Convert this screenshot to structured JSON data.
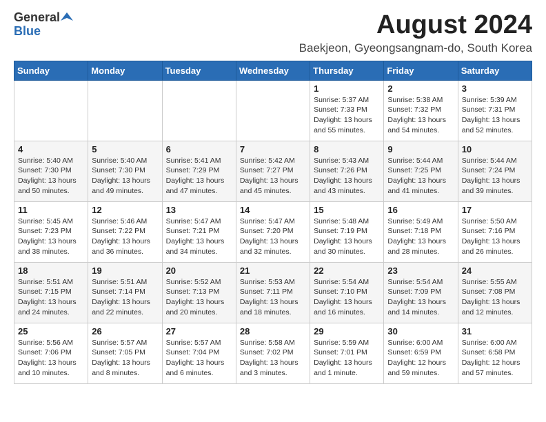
{
  "header": {
    "logo_general": "General",
    "logo_blue": "Blue",
    "title": "August 2024",
    "subtitle": "Baekjeon, Gyeongsangnam-do, South Korea"
  },
  "days_of_week": [
    "Sunday",
    "Monday",
    "Tuesday",
    "Wednesday",
    "Thursday",
    "Friday",
    "Saturday"
  ],
  "weeks": [
    [
      {
        "day": "",
        "info": ""
      },
      {
        "day": "",
        "info": ""
      },
      {
        "day": "",
        "info": ""
      },
      {
        "day": "",
        "info": ""
      },
      {
        "day": "1",
        "info": "Sunrise: 5:37 AM\nSunset: 7:33 PM\nDaylight: 13 hours\nand 55 minutes."
      },
      {
        "day": "2",
        "info": "Sunrise: 5:38 AM\nSunset: 7:32 PM\nDaylight: 13 hours\nand 54 minutes."
      },
      {
        "day": "3",
        "info": "Sunrise: 5:39 AM\nSunset: 7:31 PM\nDaylight: 13 hours\nand 52 minutes."
      }
    ],
    [
      {
        "day": "4",
        "info": "Sunrise: 5:40 AM\nSunset: 7:30 PM\nDaylight: 13 hours\nand 50 minutes."
      },
      {
        "day": "5",
        "info": "Sunrise: 5:40 AM\nSunset: 7:30 PM\nDaylight: 13 hours\nand 49 minutes."
      },
      {
        "day": "6",
        "info": "Sunrise: 5:41 AM\nSunset: 7:29 PM\nDaylight: 13 hours\nand 47 minutes."
      },
      {
        "day": "7",
        "info": "Sunrise: 5:42 AM\nSunset: 7:27 PM\nDaylight: 13 hours\nand 45 minutes."
      },
      {
        "day": "8",
        "info": "Sunrise: 5:43 AM\nSunset: 7:26 PM\nDaylight: 13 hours\nand 43 minutes."
      },
      {
        "day": "9",
        "info": "Sunrise: 5:44 AM\nSunset: 7:25 PM\nDaylight: 13 hours\nand 41 minutes."
      },
      {
        "day": "10",
        "info": "Sunrise: 5:44 AM\nSunset: 7:24 PM\nDaylight: 13 hours\nand 39 minutes."
      }
    ],
    [
      {
        "day": "11",
        "info": "Sunrise: 5:45 AM\nSunset: 7:23 PM\nDaylight: 13 hours\nand 38 minutes."
      },
      {
        "day": "12",
        "info": "Sunrise: 5:46 AM\nSunset: 7:22 PM\nDaylight: 13 hours\nand 36 minutes."
      },
      {
        "day": "13",
        "info": "Sunrise: 5:47 AM\nSunset: 7:21 PM\nDaylight: 13 hours\nand 34 minutes."
      },
      {
        "day": "14",
        "info": "Sunrise: 5:47 AM\nSunset: 7:20 PM\nDaylight: 13 hours\nand 32 minutes."
      },
      {
        "day": "15",
        "info": "Sunrise: 5:48 AM\nSunset: 7:19 PM\nDaylight: 13 hours\nand 30 minutes."
      },
      {
        "day": "16",
        "info": "Sunrise: 5:49 AM\nSunset: 7:18 PM\nDaylight: 13 hours\nand 28 minutes."
      },
      {
        "day": "17",
        "info": "Sunrise: 5:50 AM\nSunset: 7:16 PM\nDaylight: 13 hours\nand 26 minutes."
      }
    ],
    [
      {
        "day": "18",
        "info": "Sunrise: 5:51 AM\nSunset: 7:15 PM\nDaylight: 13 hours\nand 24 minutes."
      },
      {
        "day": "19",
        "info": "Sunrise: 5:51 AM\nSunset: 7:14 PM\nDaylight: 13 hours\nand 22 minutes."
      },
      {
        "day": "20",
        "info": "Sunrise: 5:52 AM\nSunset: 7:13 PM\nDaylight: 13 hours\nand 20 minutes."
      },
      {
        "day": "21",
        "info": "Sunrise: 5:53 AM\nSunset: 7:11 PM\nDaylight: 13 hours\nand 18 minutes."
      },
      {
        "day": "22",
        "info": "Sunrise: 5:54 AM\nSunset: 7:10 PM\nDaylight: 13 hours\nand 16 minutes."
      },
      {
        "day": "23",
        "info": "Sunrise: 5:54 AM\nSunset: 7:09 PM\nDaylight: 13 hours\nand 14 minutes."
      },
      {
        "day": "24",
        "info": "Sunrise: 5:55 AM\nSunset: 7:08 PM\nDaylight: 13 hours\nand 12 minutes."
      }
    ],
    [
      {
        "day": "25",
        "info": "Sunrise: 5:56 AM\nSunset: 7:06 PM\nDaylight: 13 hours\nand 10 minutes."
      },
      {
        "day": "26",
        "info": "Sunrise: 5:57 AM\nSunset: 7:05 PM\nDaylight: 13 hours\nand 8 minutes."
      },
      {
        "day": "27",
        "info": "Sunrise: 5:57 AM\nSunset: 7:04 PM\nDaylight: 13 hours\nand 6 minutes."
      },
      {
        "day": "28",
        "info": "Sunrise: 5:58 AM\nSunset: 7:02 PM\nDaylight: 13 hours\nand 3 minutes."
      },
      {
        "day": "29",
        "info": "Sunrise: 5:59 AM\nSunset: 7:01 PM\nDaylight: 13 hours\nand 1 minute."
      },
      {
        "day": "30",
        "info": "Sunrise: 6:00 AM\nSunset: 6:59 PM\nDaylight: 12 hours\nand 59 minutes."
      },
      {
        "day": "31",
        "info": "Sunrise: 6:00 AM\nSunset: 6:58 PM\nDaylight: 12 hours\nand 57 minutes."
      }
    ]
  ]
}
